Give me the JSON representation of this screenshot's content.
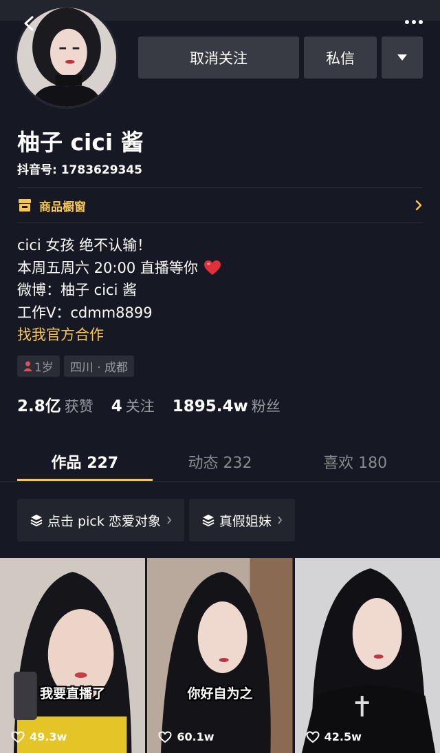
{
  "header": {
    "back_icon": "back-chevron-icon",
    "more_icon": "more-dots-icon"
  },
  "actions": {
    "unfollow_label": "取消关注",
    "message_label": "私信",
    "dropdown_icon": "triangle-down-icon"
  },
  "profile": {
    "nickname": "柚子 cici 酱",
    "douyin_id": "抖音号: 1783629345"
  },
  "shop": {
    "label": "商品橱窗",
    "icon": "shop-icon",
    "chevron_icon": "chevron-right-icon"
  },
  "bio": {
    "lines": [
      "cici 女孩 绝不认输！",
      "本周五周六 20:00 直播等你",
      "微博：柚子 cici 酱",
      "工作V：cdmm8899"
    ],
    "heart_icon": "red-heart-emoji",
    "link_text": "找我官方合作"
  },
  "tags": {
    "age": "1岁",
    "location": "四川 · 成都"
  },
  "stats": {
    "likes_value": "2.8亿",
    "likes_label": "获赞",
    "following_value": "4",
    "following_label": "关注",
    "followers_value": "1895.4w",
    "followers_label": "粉丝"
  },
  "tabs": [
    {
      "label": "作品 227",
      "active": true
    },
    {
      "label": "动态 232",
      "active": false
    },
    {
      "label": "喜欢 180",
      "active": false
    }
  ],
  "collections": [
    {
      "label": "点击 pick 恋爱对象"
    },
    {
      "label": "真假姐妹"
    }
  ],
  "videos": [
    {
      "caption": "我要直播了",
      "likes": "49.3w"
    },
    {
      "caption": "你好自为之",
      "likes": "60.1w"
    },
    {
      "caption": "",
      "likes": "42.5w"
    }
  ],
  "colors": {
    "background": "#161823",
    "button": "#393b44",
    "accent_yellow": "#f9c74f",
    "muted_text": "#9a9ba2"
  }
}
